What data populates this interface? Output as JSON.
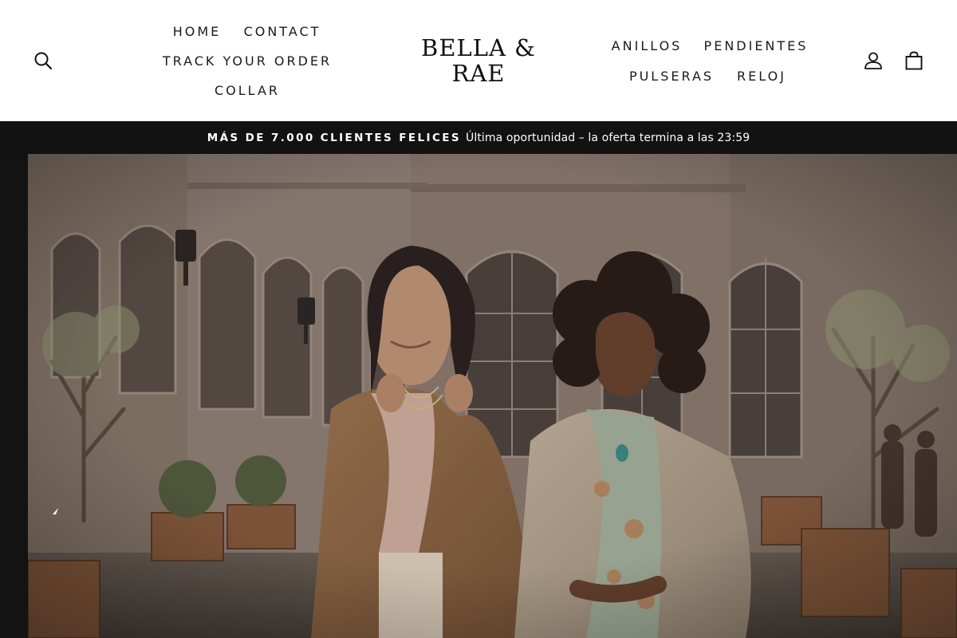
{
  "brand": {
    "line1": "BELLA &",
    "line2": "RAE"
  },
  "nav_left": {
    "home": "HOME",
    "contact": "CONTACT",
    "track": "TRACK YOUR ORDER",
    "collar": "COLLAR"
  },
  "nav_right": {
    "anillos": "ANILLOS",
    "pendientes": "PENDIENTES",
    "pulseras": "PULSERAS",
    "reloj": "RELOJ"
  },
  "icons": {
    "search": "search-icon",
    "account": "account-icon",
    "cart": "bag-icon"
  },
  "announcement": {
    "highlight": "MÁS DE 7.000 CLIENTES FELICES",
    "message": "Última oportunidad – la oferta termina a las 23:59"
  },
  "colors": {
    "announcement_bg": "#121212",
    "header_bg": "#ffffff",
    "text": "#1a1a1a"
  }
}
